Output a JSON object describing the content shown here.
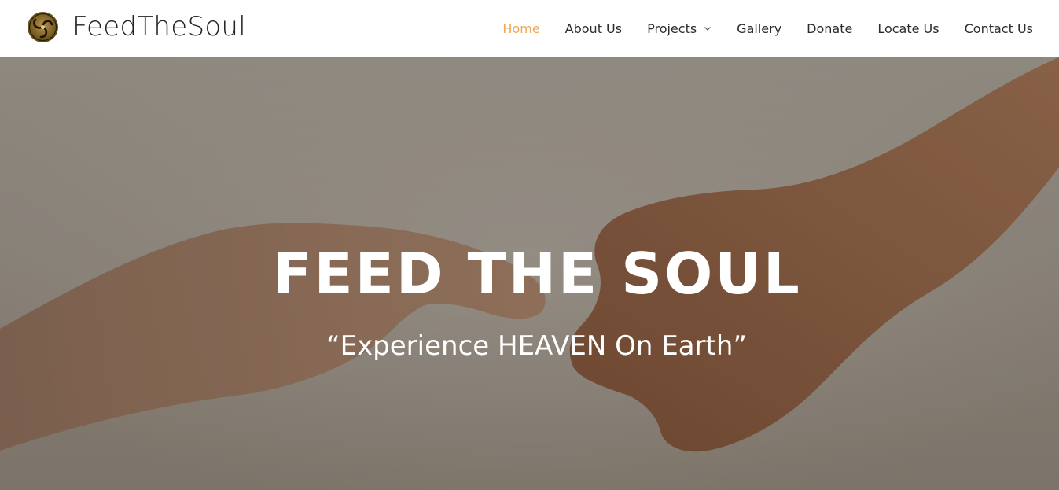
{
  "header": {
    "site_title": "FeedTheSoul",
    "logo_icon": "spiral-logo-icon",
    "nav": [
      {
        "label": "Home",
        "active": true
      },
      {
        "label": "About Us",
        "active": false
      },
      {
        "label": "Projects",
        "active": false,
        "has_dropdown": true
      },
      {
        "label": "Gallery",
        "active": false
      },
      {
        "label": "Donate",
        "active": false
      },
      {
        "label": "Locate Us",
        "active": false
      },
      {
        "label": "Contact Us",
        "active": false
      }
    ]
  },
  "hero": {
    "title": "FEED THE SOUL",
    "subtitle": "“Experience HEAVEN On Earth”",
    "background_image": "two reaching hands"
  },
  "colors": {
    "accent": "#f0a650",
    "nav_text": "#2b2b2b",
    "hero_text": "#ffffff",
    "logo_gold": "#8a6d2c"
  }
}
